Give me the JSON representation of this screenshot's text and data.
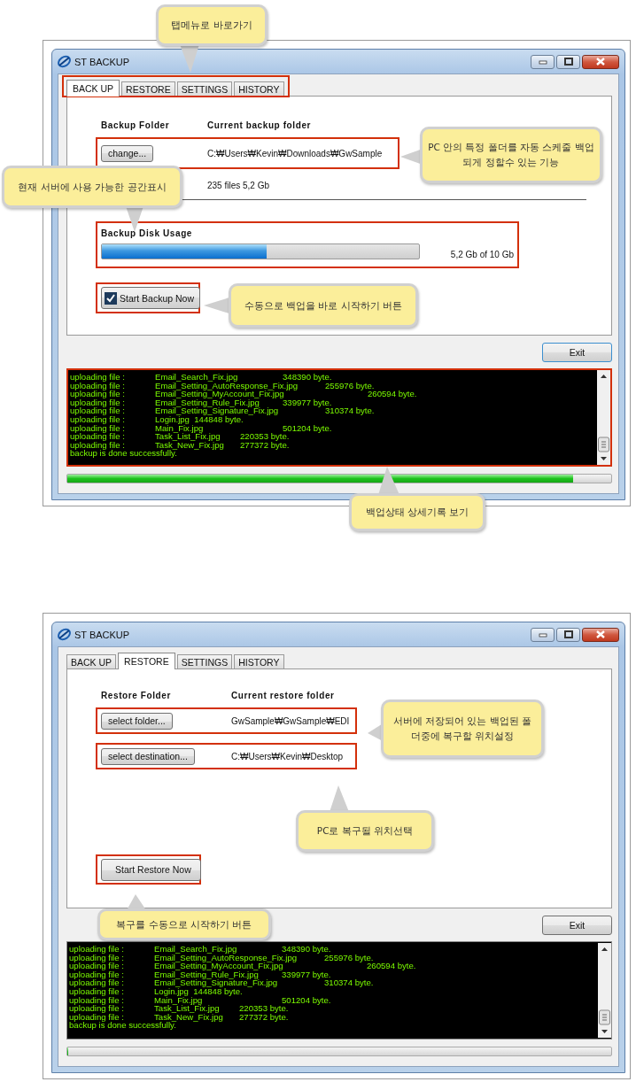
{
  "sections": [
    {
      "kind": "backup",
      "window": {
        "title": "ST BACKUP"
      },
      "tabs": [
        {
          "label": "BACK UP",
          "selected": true
        },
        {
          "label": "RESTORE",
          "selected": false
        },
        {
          "label": "SETTINGS",
          "selected": false
        },
        {
          "label": "HISTORY",
          "selected": false
        }
      ],
      "columns": [
        "Backup Folder",
        "Current backup folder"
      ],
      "rows": [
        {
          "button": "change...",
          "path": "C:₩Users₩Kevin₩Downloads₩GwSample"
        }
      ],
      "stats": "235 files 5,2 Gb",
      "disk_usage": {
        "label": "Backup Disk Usage",
        "level": 0.52,
        "reading": "5,2 Gb of 10 Gb"
      },
      "start_button": {
        "label": "Start Backup Now",
        "checked": true
      },
      "exit_button": "Exit",
      "log": [
        "uploading file :\tEmail_Search_Fix.jpg\t\t348390 byte.",
        "uploading file :\tEmail_Setting_AutoResponse_Fix.jpg\t255976 byte.",
        "uploading file :\tEmail_Setting_MyAccount_Fix.jpg\t\t260594 byte.",
        "uploading file :\tEmail_Setting_Rule_Fix.jpg\t339977 byte.",
        "uploading file :\tEmail_Setting_Signature_Fix.jpg\t\t310374 byte.",
        "uploading file :\tLogin.jpg  144848 byte.",
        "uploading file :\tMain_Fix.jpg\t\t501204 byte.",
        "uploading file :\tTask_List_Fix.jpg\t220353 byte.",
        "uploading file :\tTask_New_Fix.jpg\t277372 byte.",
        "backup is done successfully."
      ],
      "progress": {
        "level": 0.93
      },
      "callouts": [
        {
          "text": "탭메뉴로 바로가기"
        },
        {
          "text": "현재 서버에 사용 가능한 공간표시"
        },
        {
          "text": "PC 안의 특정 폴더를 자동 스케줄 백업되게 정할수 있는 기능"
        },
        {
          "text": "수동으로 백업을 바로 시작하기 버튼"
        },
        {
          "text": "백업상태 상세기록 보기"
        }
      ]
    },
    {
      "kind": "restore",
      "window": {
        "title": "ST BACKUP"
      },
      "tabs": [
        {
          "label": "BACK UP",
          "selected": false
        },
        {
          "label": "RESTORE",
          "selected": true
        },
        {
          "label": "SETTINGS",
          "selected": false
        },
        {
          "label": "HISTORY",
          "selected": false
        }
      ],
      "columns": [
        "Restore Folder",
        "Current restore folder"
      ],
      "rows": [
        {
          "button": "select folder...",
          "path": "GwSample₩GwSample₩EDI"
        },
        {
          "button": "select destination...",
          "path": "C:₩Users₩Kevin₩Desktop"
        }
      ],
      "start_button": {
        "label": "Start Restore Now"
      },
      "exit_button": "Exit",
      "log": [
        "uploading file :\tEmail_Search_Fix.jpg\t\t348390 byte.",
        "uploading file :\tEmail_Setting_AutoResponse_Fix.jpg\t255976 byte.",
        "uploading file :\tEmail_Setting_MyAccount_Fix.jpg\t\t260594 byte.",
        "uploading file :\tEmail_Setting_Rule_Fix.jpg\t339977 byte.",
        "uploading file :\tEmail_Setting_Signature_Fix.jpg\t\t310374 byte.",
        "uploading file :\tLogin.jpg  144848 byte.",
        "uploading file :\tMain_Fix.jpg\t\t501204 byte.",
        "uploading file :\tTask_List_Fix.jpg\t220353 byte.",
        "uploading file :\tTask_New_Fix.jpg\t277372 byte.",
        "backup is done successfully."
      ],
      "progress": {
        "level": 0
      },
      "callouts": [
        {
          "text": "서버에 저장되어 있는 백업된 폴더중에 복구할 위치설정"
        },
        {
          "text": "PC로 복구될 위치선택"
        },
        {
          "text": "복구를 수동으로 시작하기 버튼"
        }
      ]
    }
  ]
}
